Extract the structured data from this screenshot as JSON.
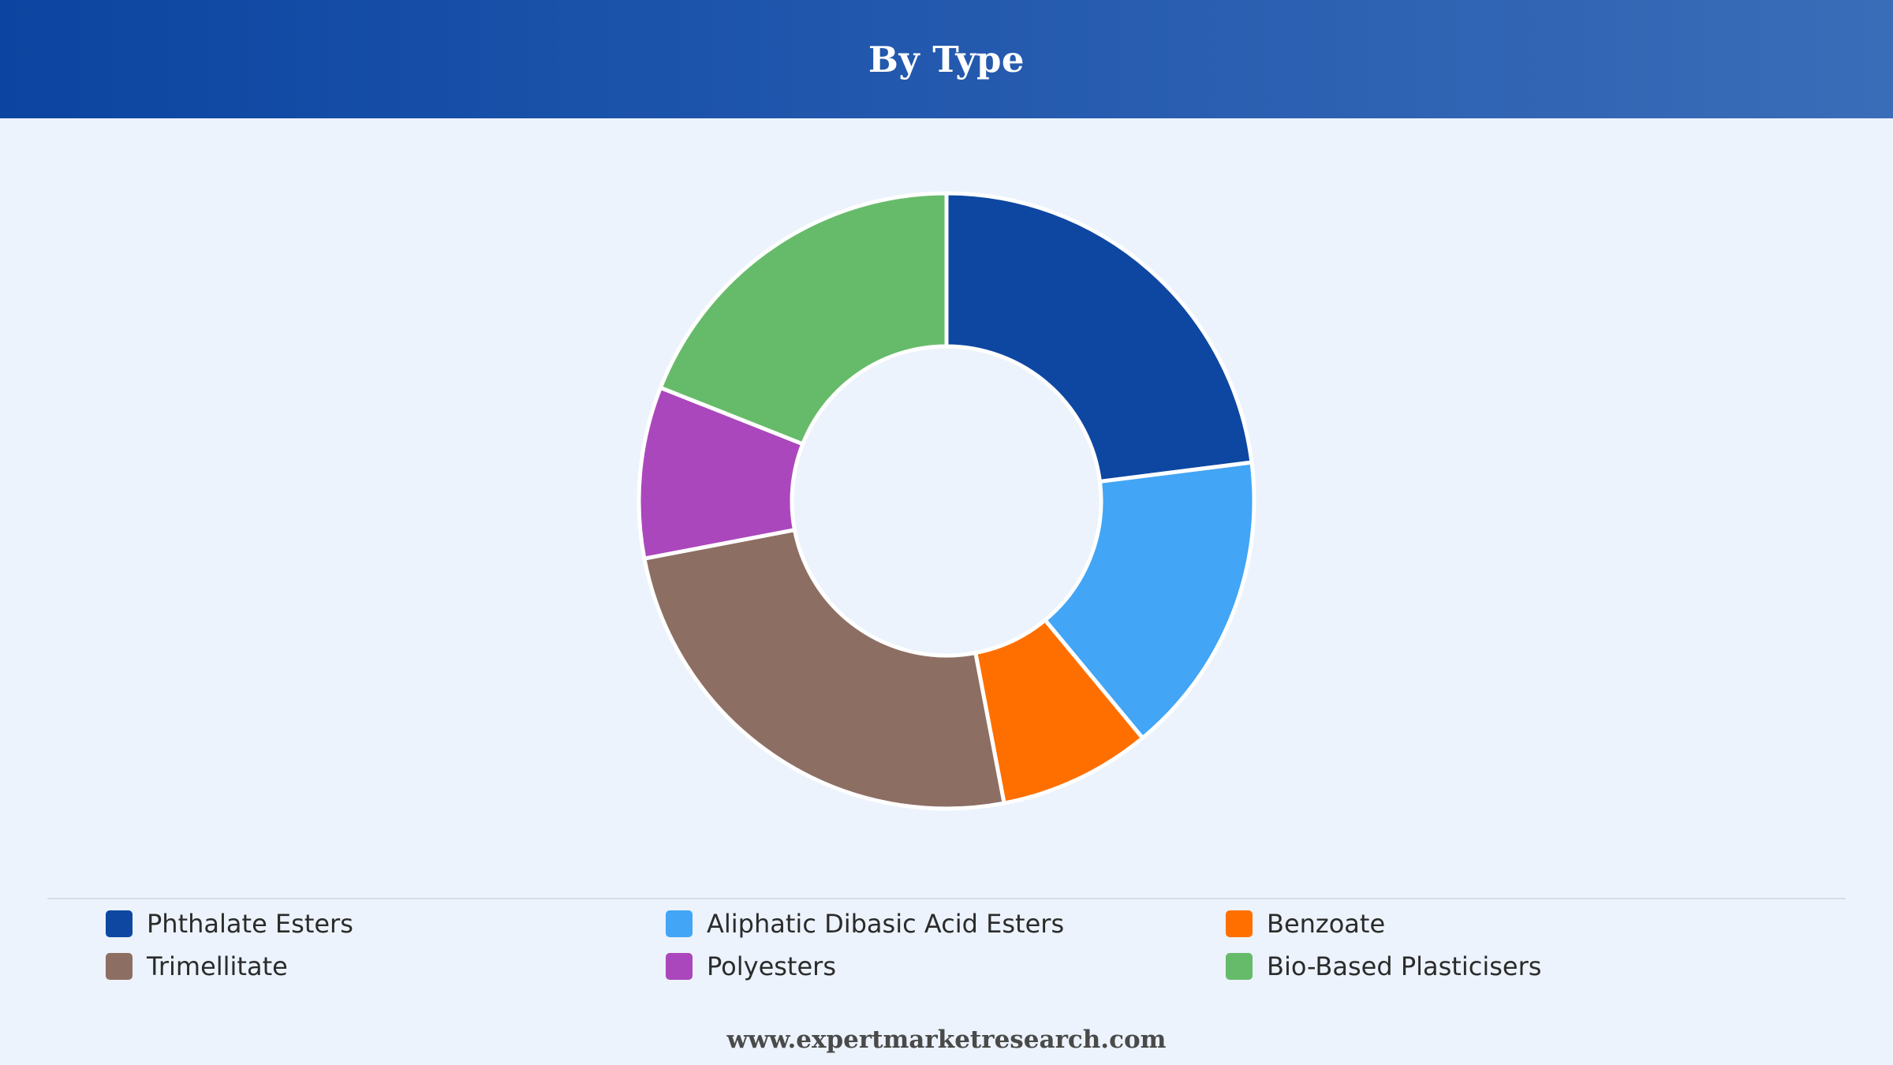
{
  "header": {
    "title": "By Type",
    "background_start": "#0b45a1",
    "background_end": "#3a6db8"
  },
  "chart_data": {
    "type": "pie",
    "variant": "donut",
    "title": "By Type",
    "categories": [
      "Phthalate Esters",
      "Aliphatic Dibasic Acid Esters",
      "Benzoate",
      "Trimellitate",
      "Polyesters",
      "Bio-Based Plasticisers"
    ],
    "values": [
      23,
      16,
      8,
      25,
      9,
      19
    ],
    "unit": "%",
    "colors": [
      "#0d47a1",
      "#42a5f5",
      "#ff6f00",
      "#8d6e63",
      "#ab47bc",
      "#66bb6a"
    ],
    "legend_placement": "bottom"
  },
  "legend": {
    "items": [
      {
        "label": "Phthalate Esters",
        "color": "#0d47a1"
      },
      {
        "label": "Aliphatic Dibasic Acid Esters",
        "color": "#42a5f5"
      },
      {
        "label": "Benzoate",
        "color": "#ff6f00"
      },
      {
        "label": "Trimellitate",
        "color": "#8d6e63"
      },
      {
        "label": "Polyesters",
        "color": "#ab47bc"
      },
      {
        "label": "Bio-Based Plasticisers",
        "color": "#66bb6a"
      }
    ]
  },
  "footer": {
    "source": "www.expertmarketresearch.com"
  }
}
